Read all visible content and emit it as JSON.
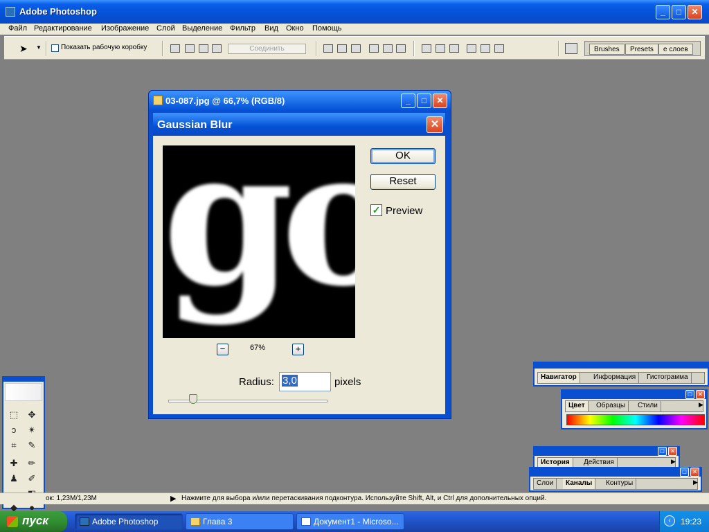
{
  "app": {
    "title": "Adobe Photoshop"
  },
  "menu": [
    "Файл",
    "Редактирование",
    "Изображение",
    "Слой",
    "Выделение",
    "Фильтр",
    "Вид",
    "Окно",
    "Помощь"
  ],
  "options": {
    "show_box_label": "Показать рабочую коробку",
    "combine_label": "Соединить",
    "palette_tabs": [
      "Brushes",
      "Presets",
      "е слоев"
    ]
  },
  "document": {
    "title": "03-087.jpg @ 66,7% (RGB/8)"
  },
  "dialog": {
    "title": "Gaussian Blur",
    "ok_label": "OK",
    "reset_label": "Reset",
    "preview_label": "Preview",
    "preview_checked": true,
    "preview_text": "go",
    "zoom_label": "67%",
    "zoom_minus": "−",
    "zoom_plus": "+",
    "radius_label": "Radius:",
    "radius_value": "3,0",
    "radius_unit": "pixels"
  },
  "palettes": {
    "navigator_tabs": [
      "Навигатор",
      "Информация",
      "Гистограмма"
    ],
    "color_tabs": [
      "Цвет",
      "Образцы",
      "Стили"
    ],
    "history_tabs": [
      "История",
      "Действия"
    ],
    "layers_tabs": [
      "Слои",
      "Каналы",
      "Контуры"
    ]
  },
  "status": {
    "doc_size": "ок: 1,23M/1,23M",
    "hint": "Нажмите для выбора и/или перетаскивания подконтура.  Используйте Shift, Alt, и Ctrl для дополнительных опций."
  },
  "taskbar": {
    "start_label": "пуск",
    "tasks": [
      "Adobe Photoshop",
      "Глава 3",
      "Документ1 - Microso..."
    ],
    "clock": "19:23"
  },
  "colors": {
    "xp_blue": "#0451d6",
    "dialog_bg": "#ece9d8",
    "workspace": "#808080",
    "start_green": "#2f8a2f"
  }
}
